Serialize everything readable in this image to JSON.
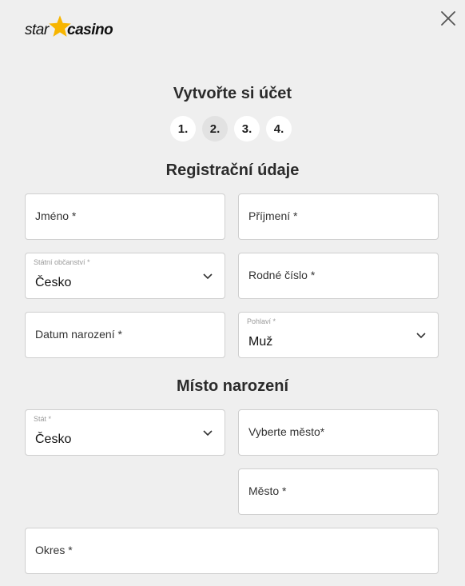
{
  "brand": {
    "part1": "star",
    "part2": "casino",
    "star_color": "#f7b500"
  },
  "page": {
    "title": "Vytvořte si účet"
  },
  "steps": {
    "s1": "1.",
    "s2": "2.",
    "s3": "3.",
    "s4": "4.",
    "active": 2
  },
  "sections": {
    "registration": "Registrační údaje",
    "birthplace": "Místo narození"
  },
  "fields": {
    "first_name": "Jméno *",
    "last_name": "Příjmení *",
    "citizenship": {
      "label": "Státní občanství *",
      "value": "Česko"
    },
    "birth_number": "Rodné číslo *",
    "birth_date": "Datum narození *",
    "gender": {
      "label": "Pohlaví *",
      "value": "Muž"
    },
    "country": {
      "label": "Stát *",
      "value": "Česko"
    },
    "select_city": "Vyberte město*",
    "city": "Město *",
    "district": "Okres *"
  }
}
